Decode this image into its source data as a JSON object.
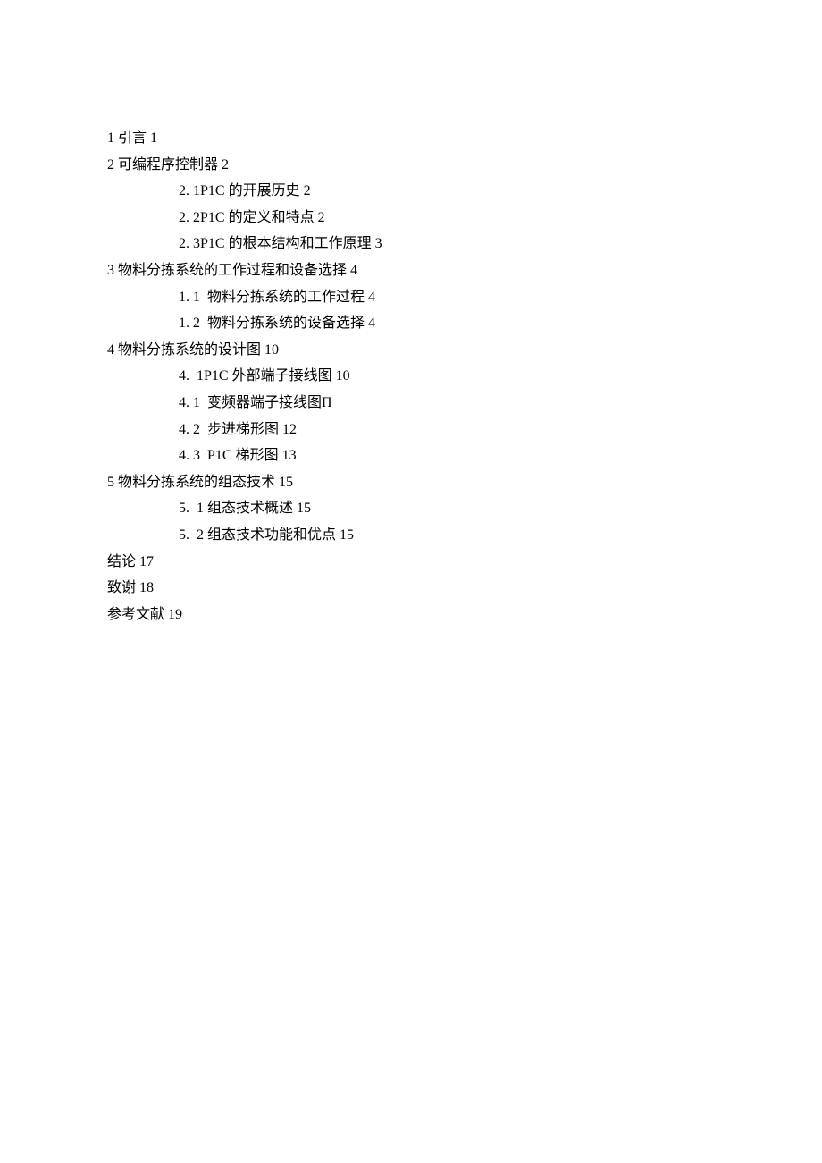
{
  "toc": {
    "s1": {
      "label": "1 引言 1"
    },
    "s2": {
      "label": "2 可编程序控制器 2",
      "s2_1": {
        "label": "2. 1P1C 的开展历史 2"
      },
      "s2_2": {
        "label": "2. 2P1C 的定义和特点 2"
      },
      "s2_3": {
        "label": "2. 3P1C 的根本结构和工作原理 3"
      }
    },
    "s3": {
      "label": "3 物料分拣系统的工作过程和设备选择 4",
      "s3_1": {
        "label": "1. 1  物料分拣系统的工作过程 4"
      },
      "s3_2": {
        "label": "1. 2  物料分拣系统的设备选择 4"
      }
    },
    "s4": {
      "label": "4 物料分拣系统的设计图 10",
      "s4_1": {
        "label": "4.  1P1C 外部端子接线图 10"
      },
      "s4_2": {
        "label": "4. 1  变频器端子接线图Π"
      },
      "s4_3": {
        "label": "4. 2  步进梯形图 12"
      },
      "s4_4": {
        "label": "4. 3  P1C 梯形图 13"
      }
    },
    "s5": {
      "label": "5 物料分拣系统的组态技术 15",
      "s5_1": {
        "label": "5.  1 组态技术概述 15"
      },
      "s5_2": {
        "label": "5.  2 组态技术功能和优点 15"
      }
    },
    "conclusion": {
      "label": "结论 17"
    },
    "thanks": {
      "label": "致谢 18"
    },
    "references": {
      "label": "参考文献 19"
    }
  }
}
